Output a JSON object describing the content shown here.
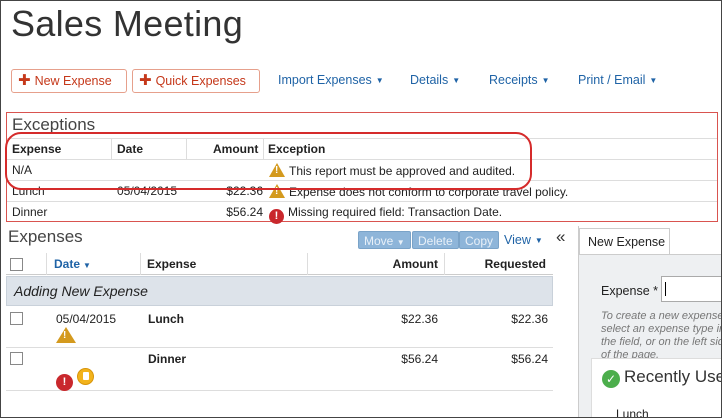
{
  "title": "Sales Meeting",
  "toolbar": {
    "new_expense": "New Expense",
    "quick_expenses": "Quick Expenses",
    "menus": [
      "Import Expenses",
      "Details",
      "Receipts",
      "Print / Email"
    ]
  },
  "exceptions": {
    "title": "Exceptions",
    "columns": [
      "Expense",
      "Date",
      "Amount",
      "Exception"
    ],
    "rows": [
      {
        "expense": "N/A",
        "date": "",
        "amount": "",
        "icon": "warning-icon",
        "message": "This report must be approved and audited."
      },
      {
        "expense": "Lunch",
        "date": "05/04/2015",
        "amount": "$22.36",
        "icon": "warning-icon",
        "message": "Expense does not conform to corporate travel policy."
      },
      {
        "expense": "Dinner",
        "date": "",
        "amount": "$56.24",
        "icon": "error-icon",
        "message": "Missing required field: Transaction Date."
      }
    ]
  },
  "expenses": {
    "title": "Expenses",
    "actions": {
      "move": "Move",
      "delete": "Delete",
      "copy": "Copy",
      "view": "View"
    },
    "collapse": "«",
    "columns": {
      "date": "Date",
      "expense": "Expense",
      "amount": "Amount",
      "requested": "Requested"
    },
    "adding": "Adding New Expense",
    "rows": [
      {
        "date": "05/04/2015",
        "expense": "Lunch",
        "amount": "$22.36",
        "requested": "$22.36"
      },
      {
        "date": "",
        "expense": "Dinner",
        "amount": "$56.24",
        "requested": "$56.24"
      }
    ]
  },
  "panel": {
    "tab": "New Expense",
    "expense_label": "Expense *",
    "hint": "To create a new expense, select an expense type in the field, or on the left side of the page.",
    "recently": "Recently Used",
    "recent_items": [
      "Lunch"
    ]
  },
  "colors": {
    "accent": "#1f63a6",
    "brand_red": "#c5381a",
    "warning": "#d49a1e",
    "error": "#c9282d",
    "success": "#4cae4c"
  }
}
